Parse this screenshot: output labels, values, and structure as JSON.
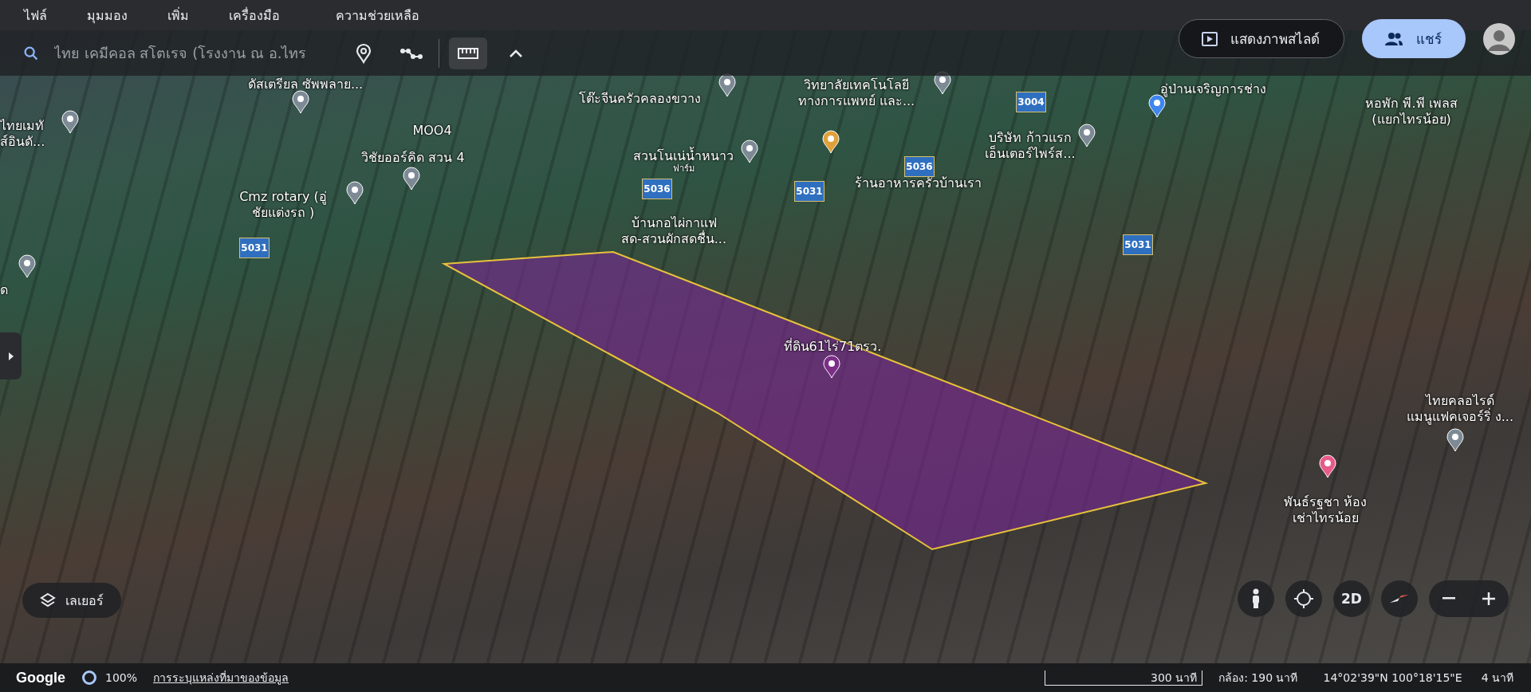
{
  "menu_bar": {
    "items": [
      "ไฟล์",
      "มุมมอง",
      "เพิ่ม",
      "เครื่องมือ",
      "ความช่วยเหลือ"
    ]
  },
  "search": {
    "value": "ไทย เคมีคอล สโตเรจ (โรงงาน ณ อ.ไทร"
  },
  "tools": [
    {
      "kind": "placemark",
      "selected": false
    },
    {
      "kind": "path",
      "selected": false
    },
    {
      "kind": "ruler",
      "selected": true
    },
    {
      "kind": "collapse",
      "selected": false
    }
  ],
  "slideshow_button": {
    "label": "แสดงภาพสไลด์"
  },
  "share_button": {
    "label": "แชร์"
  },
  "map": {
    "labels": [
      {
        "text": "ไทยเมทั\nส์อินดั...",
        "kind": "place"
      },
      {
        "text": "ดัสเตรียล ซัพพลาย...",
        "kind": "place"
      },
      {
        "text": "MOO4",
        "kind": "plain"
      },
      {
        "text": "วิชัยออร์คิด สวน 4",
        "kind": "place"
      },
      {
        "text": "Cmz rotary (อู่\nชัยแต่งรถ )",
        "kind": "place"
      },
      {
        "text": "โต๊ะจีนครัวคลองขวาง",
        "kind": "place"
      },
      {
        "text": "สวนโนเน่น้ำหนาว",
        "sub": "ฟาร์ม",
        "kind": "place"
      },
      {
        "text": "บ้านกอไผ่กาแฟ\nสด-สวนผักสดชื่น...",
        "kind": "plain"
      },
      {
        "text": "วิทยาลัยเทคโนโลยี\nทางการแพทย์ และ...",
        "kind": "place"
      },
      {
        "text": "ร้านอาหารครัวบ้านเรา",
        "kind": "restaurant"
      },
      {
        "text": "บริษัท ก้าวแรก\nเอ็นเตอร์ไพร์ส...",
        "kind": "place"
      },
      {
        "text": "อู่ป่านเจริญการช่าง",
        "kind": "shop"
      },
      {
        "text": "หอพัก พี.พี เพลส\n(แยกไทรน้อย)",
        "kind": "plain"
      },
      {
        "text": "ที่ดิน61ไร่71ตรว.",
        "kind": "land"
      },
      {
        "text": "ไทยคลอไรด์\nแมนูแฟคเจอร์ริ่ ง...",
        "kind": "place"
      },
      {
        "text": "พันธ์รฐชา ห้อง\nเช่าไทรน้อย",
        "kind": "room"
      },
      {
        "text": "ด",
        "kind": "place"
      }
    ],
    "route_signs": [
      "5031",
      "5036",
      "5031",
      "5036",
      "3004",
      "5031"
    ]
  },
  "layers_button": {
    "label": "เลเยอร์"
  },
  "map_controls": {
    "view_mode": "2D"
  },
  "status_bar": {
    "logo": "Google",
    "loading": "100%",
    "attribution": "การระบุแหล่งที่มาของข้อมูล",
    "scale": "300 นาที",
    "camera": "กล้อง: 190 นาที",
    "coordinates": "14°02'39\"N 100°18'15\"E",
    "elevation": "4 นาที"
  }
}
